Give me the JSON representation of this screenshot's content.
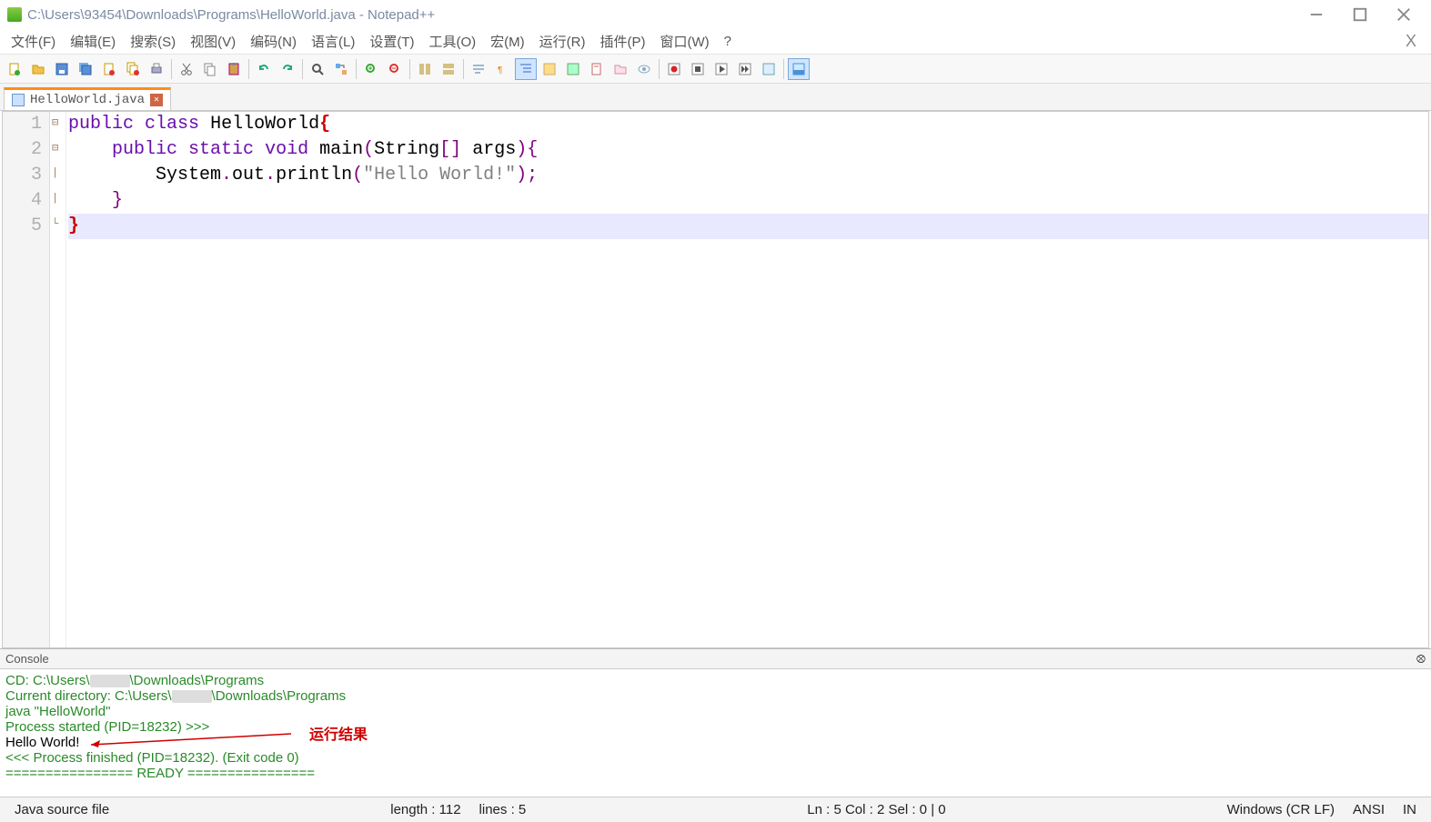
{
  "titlebar": {
    "title": "C:\\Users\\93454\\Downloads\\Programs\\HelloWorld.java - Notepad++"
  },
  "menu": {
    "items": [
      "文件(F)",
      "编辑(E)",
      "搜索(S)",
      "视图(V)",
      "编码(N)",
      "语言(L)",
      "设置(T)",
      "工具(O)",
      "宏(M)",
      "运行(R)",
      "插件(P)",
      "窗口(W)",
      "?"
    ],
    "rightClose": "X"
  },
  "toolbar": {
    "icons": [
      "new",
      "open",
      "save",
      "save-all",
      "close",
      "close-all",
      "print",
      "cut",
      "copy",
      "paste",
      "undo",
      "redo",
      "find",
      "replace",
      "zoom-in",
      "zoom-out",
      "sync",
      "wrap",
      "show-all",
      "indent",
      "fold",
      "unfold",
      "hide",
      "macro-rec",
      "macro-stop",
      "macro-play",
      "macro-fast",
      "macro-list",
      "monitor"
    ]
  },
  "tab": {
    "filename": "HelloWorld.java"
  },
  "editor": {
    "lines": [
      {
        "n": "1",
        "fold": "⊟",
        "parts": [
          {
            "t": "public",
            "c": "kw"
          },
          {
            "t": " ",
            "c": ""
          },
          {
            "t": "class",
            "c": "kw"
          },
          {
            "t": " ",
            "c": ""
          },
          {
            "t": "HelloWorld",
            "c": "cls"
          },
          {
            "t": "{",
            "c": "punc-red"
          }
        ]
      },
      {
        "n": "2",
        "fold": "⊟",
        "indent": "    ",
        "parts": [
          {
            "t": "public",
            "c": "kw"
          },
          {
            "t": " ",
            "c": ""
          },
          {
            "t": "static",
            "c": "kw"
          },
          {
            "t": " ",
            "c": ""
          },
          {
            "t": "void",
            "c": "kw"
          },
          {
            "t": " ",
            "c": ""
          },
          {
            "t": "main",
            "c": "cls"
          },
          {
            "t": "(",
            "c": "punc"
          },
          {
            "t": "String",
            "c": "cls"
          },
          {
            "t": "[]",
            "c": "punc"
          },
          {
            "t": " ",
            "c": ""
          },
          {
            "t": "args",
            "c": "cls"
          },
          {
            "t": ")",
            "c": "punc"
          },
          {
            "t": "{",
            "c": "punc"
          }
        ]
      },
      {
        "n": "3",
        "fold": "|",
        "indent": "        ",
        "parts": [
          {
            "t": "System",
            "c": "cls"
          },
          {
            "t": ".",
            "c": "punc"
          },
          {
            "t": "out",
            "c": "cls"
          },
          {
            "t": ".",
            "c": "punc"
          },
          {
            "t": "println",
            "c": "cls"
          },
          {
            "t": "(",
            "c": "punc"
          },
          {
            "t": "\"Hello World!\"",
            "c": "str"
          },
          {
            "t": ")",
            "c": "punc"
          },
          {
            "t": ";",
            "c": "punc"
          }
        ]
      },
      {
        "n": "4",
        "fold": "|",
        "indent": "    ",
        "parts": [
          {
            "t": "}",
            "c": "punc"
          }
        ]
      },
      {
        "n": "5",
        "fold": "└",
        "indent": "",
        "parts": [
          {
            "t": "}",
            "c": "punc-red"
          }
        ],
        "current": true
      }
    ]
  },
  "console": {
    "title": "Console",
    "lines": [
      {
        "c": "green",
        "pre": "CD: C:\\Users\\",
        "redact": true,
        "post": "\\Downloads\\Programs"
      },
      {
        "c": "green",
        "pre": "Current directory: C:\\Users\\",
        "redact": true,
        "post": "\\Downloads\\Programs"
      },
      {
        "c": "green",
        "t": "java \"HelloWorld\""
      },
      {
        "c": "green",
        "t": "Process started (PID=18232) >>>"
      },
      {
        "c": "black",
        "t": "Hello World!"
      },
      {
        "c": "green",
        "t": "<<< Process finished (PID=18232). (Exit code 0)"
      },
      {
        "c": "green",
        "t": "================ READY ================"
      }
    ],
    "annotation": "运行结果"
  },
  "status": {
    "left": "Java source file",
    "length": "length : 112",
    "lines": "lines : 5",
    "pos": "Ln : 5    Col : 2    Sel : 0 | 0",
    "eol": "Windows (CR LF)",
    "enc": "ANSI",
    "ins": "IN"
  }
}
